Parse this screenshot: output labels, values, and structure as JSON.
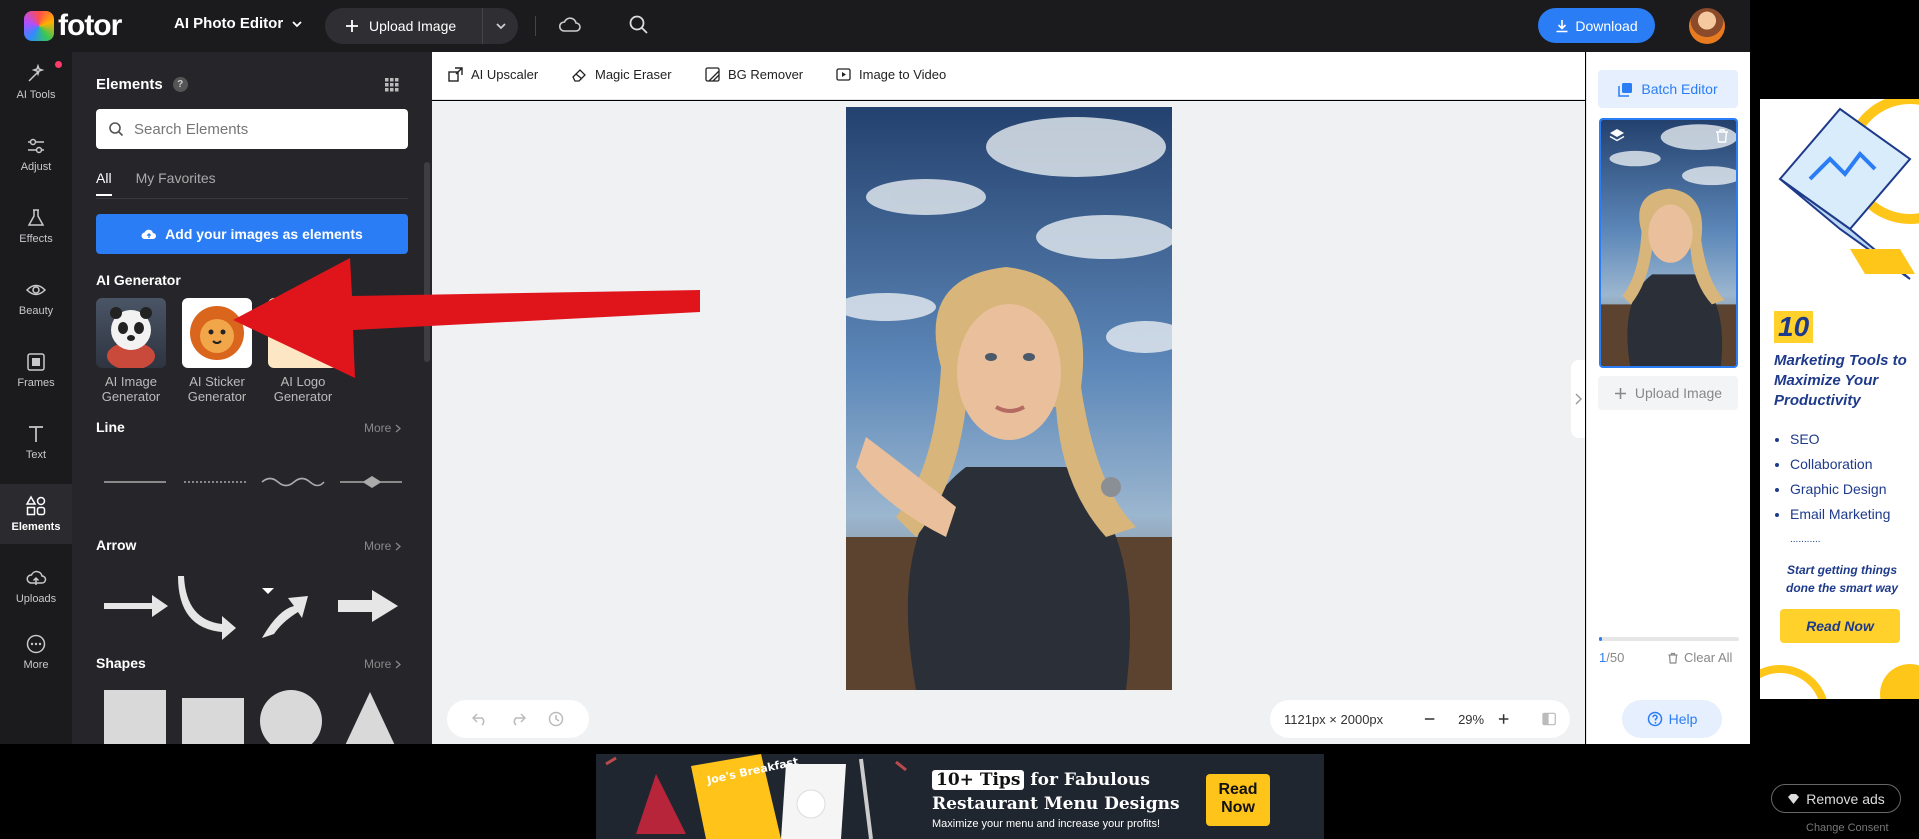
{
  "header": {
    "logo_text": "fotor",
    "app_switcher": "AI Photo Editor",
    "upload_label": "Upload Image",
    "download_label": "Download"
  },
  "rail": [
    {
      "label": "AI Tools"
    },
    {
      "label": "Adjust"
    },
    {
      "label": "Effects"
    },
    {
      "label": "Beauty"
    },
    {
      "label": "Frames"
    },
    {
      "label": "Text"
    },
    {
      "label": "Elements"
    },
    {
      "label": "Uploads"
    },
    {
      "label": "More"
    }
  ],
  "panel": {
    "title": "Elements",
    "help_glyph": "?",
    "search_placeholder": "Search Elements",
    "tabs": [
      "All",
      "My Favorites"
    ],
    "add_images_label": "Add your images as elements",
    "ai_generator_title": "AI Generator",
    "generators": [
      {
        "label": "AI Image Generator"
      },
      {
        "label": "AI Sticker Generator"
      },
      {
        "label": "AI Logo Generator"
      }
    ],
    "line_title": "Line",
    "arrow_title": "Arrow",
    "shapes_title": "Shapes",
    "more_label": "More"
  },
  "toolbar": {
    "tools": [
      "AI Upscaler",
      "Magic Eraser",
      "BG Remover",
      "Image to Video"
    ]
  },
  "canvas": {
    "dimensions": "1121px × 2000px",
    "zoom": "29%"
  },
  "right_panel": {
    "batch_editor_label": "Batch Editor",
    "upload_image_label": "Upload Image",
    "progress": 0.02,
    "count_current": "1",
    "count_total": "/50",
    "clear_all_label": "Clear All",
    "help_label": "Help"
  },
  "side_ad": {
    "number": "10",
    "headline": "Marketing Tools to Maximize Your Productivity",
    "bullets": [
      "SEO",
      "Collaboration",
      "Graphic Design",
      "Email Marketing",
      "..........."
    ],
    "tagline": "Start getting things done the smart way",
    "cta": "Read Now"
  },
  "bottom_ad": {
    "menu_text": "Joe's Breakfast",
    "tip_tag": "10+ Tips",
    "line1": "for Fabulous",
    "line2": "Restaurant Menu Designs",
    "sub": "Maximize your menu and increase your profits!",
    "cta": "Read Now"
  },
  "remove_ads_label": "Remove ads",
  "change_consent_label": "Change Consent",
  "colors": {
    "accent": "#2b7df5",
    "dark_bg": "#1b1b1e",
    "panel_bg": "#26262a",
    "annotation_arrow": "#e0151b"
  }
}
